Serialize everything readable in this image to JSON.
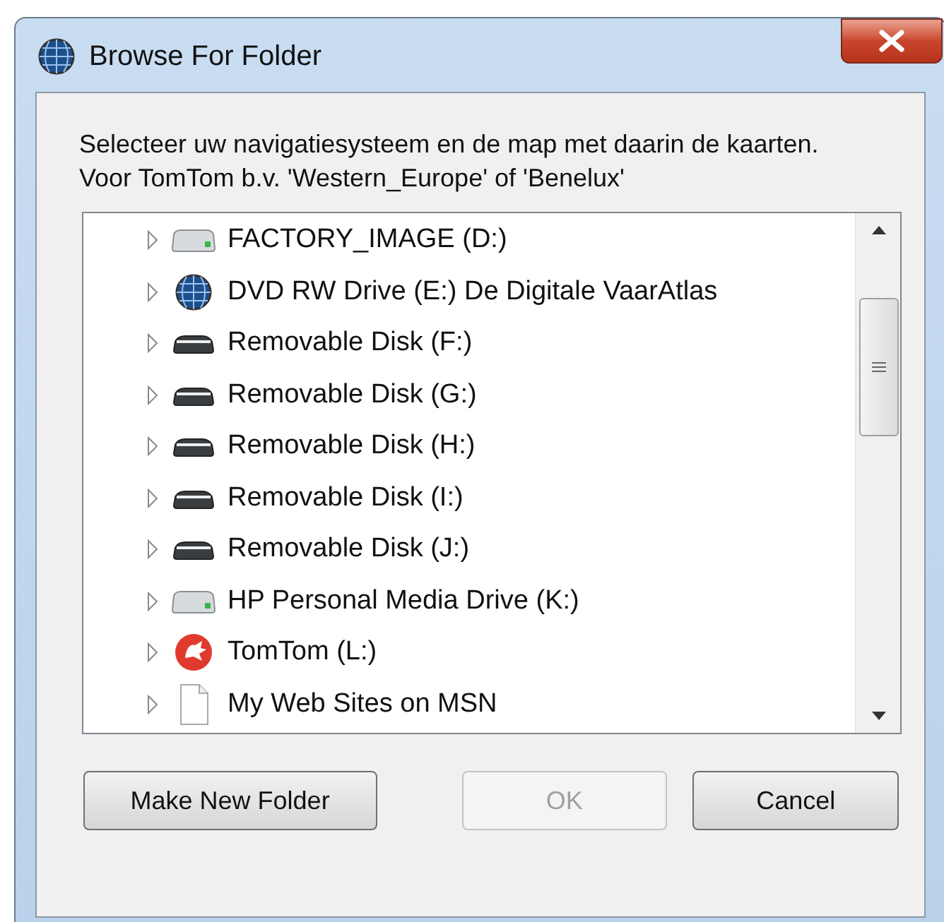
{
  "window": {
    "title": "Browse For Folder"
  },
  "description": [
    "Selecteer uw navigatiesysteem en de map met daarin de kaarten.",
    "Voor TomTom b.v. 'Western_Europe' of 'Benelux'"
  ],
  "tree": {
    "items": [
      {
        "label": "FACTORY_IMAGE (D:)",
        "kind": "drive",
        "selected": false
      },
      {
        "label": "DVD RW Drive (E:) De Digitale VaarAtlas",
        "kind": "globe",
        "selected": false
      },
      {
        "label": "Removable Disk (F:)",
        "kind": "removable",
        "selected": false
      },
      {
        "label": "Removable Disk (G:)",
        "kind": "removable",
        "selected": false
      },
      {
        "label": "Removable Disk (H:)",
        "kind": "removable",
        "selected": false
      },
      {
        "label": "Removable Disk (I:)",
        "kind": "removable",
        "selected": false
      },
      {
        "label": "Removable Disk (J:)",
        "kind": "removable",
        "selected": false
      },
      {
        "label": "HP Personal Media Drive (K:)",
        "kind": "drive",
        "selected": false
      },
      {
        "label": "TomTom (L:)",
        "kind": "tomtom",
        "selected": false
      },
      {
        "label": "My Web Sites on MSN",
        "kind": "page",
        "selected": false
      }
    ]
  },
  "buttons": [
    {
      "label": "Make New Folder",
      "disabled": false
    },
    {
      "label": "OK",
      "disabled": true
    },
    {
      "label": "Cancel",
      "disabled": false
    }
  ]
}
